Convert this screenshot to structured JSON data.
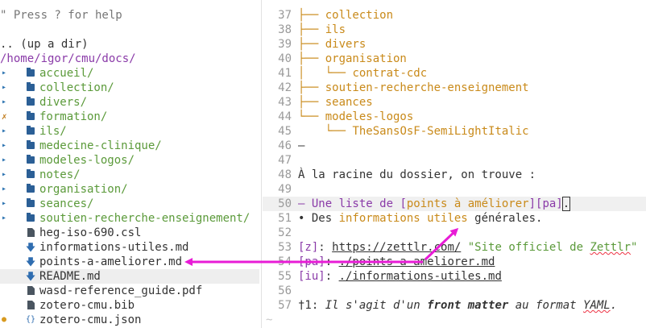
{
  "tree": {
    "help": "\" Press ? for help",
    "up_dir": ".. (up a dir)",
    "root_path": "/home/igor/cmu/docs/",
    "items": [
      {
        "type": "dir",
        "name": "accueil/",
        "glyph": "▸"
      },
      {
        "type": "dir",
        "name": "collection/",
        "glyph": "▸"
      },
      {
        "type": "dir",
        "name": "divers/",
        "glyph": "▸"
      },
      {
        "type": "dir",
        "name": "formation/",
        "glyph": "✗"
      },
      {
        "type": "dir",
        "name": "ils/",
        "glyph": "▸"
      },
      {
        "type": "dir",
        "name": "medecine-clinique/",
        "glyph": "▸"
      },
      {
        "type": "dir",
        "name": "modeles-logos/",
        "glyph": "▸"
      },
      {
        "type": "dir",
        "name": "notes/",
        "glyph": "▸"
      },
      {
        "type": "dir",
        "name": "organisation/",
        "glyph": "▸"
      },
      {
        "type": "dir",
        "name": "seances/",
        "glyph": "▸"
      },
      {
        "type": "dir",
        "name": "soutien-recherche-enseignement/",
        "glyph": "▸"
      },
      {
        "type": "file",
        "name": "heg-iso-690.csl",
        "icon": "file-icon"
      },
      {
        "type": "md",
        "name": "informations-utiles.md",
        "icon": "markdown-icon"
      },
      {
        "type": "md",
        "name": "points-a-ameliorer.md",
        "icon": "markdown-icon"
      },
      {
        "type": "md",
        "name": "README.md",
        "icon": "markdown-icon",
        "selected": true
      },
      {
        "type": "file",
        "name": "wasd-reference_guide.pdf",
        "icon": "file-icon"
      },
      {
        "type": "file",
        "name": "zotero-cmu.bib",
        "icon": "file-icon"
      },
      {
        "type": "json",
        "name": "zotero-cmu.json",
        "icon": "json-icon",
        "glyph": "●"
      }
    ]
  },
  "editor": {
    "lines": [
      {
        "n": "37",
        "segs": [
          {
            "t": "├── ",
            "c": "orange"
          },
          {
            "t": "collection",
            "c": "orange"
          }
        ]
      },
      {
        "n": "38",
        "segs": [
          {
            "t": "├── ",
            "c": "orange"
          },
          {
            "t": "ils",
            "c": "orange"
          }
        ]
      },
      {
        "n": "39",
        "segs": [
          {
            "t": "├── ",
            "c": "orange"
          },
          {
            "t": "divers",
            "c": "orange"
          }
        ]
      },
      {
        "n": "40",
        "segs": [
          {
            "t": "├── ",
            "c": "orange"
          },
          {
            "t": "organisation",
            "c": "orange"
          }
        ]
      },
      {
        "n": "41",
        "segs": [
          {
            "t": "│   └── ",
            "c": "orange"
          },
          {
            "t": "contrat-cdc",
            "c": "orange"
          }
        ]
      },
      {
        "n": "42",
        "segs": [
          {
            "t": "├── ",
            "c": "orange"
          },
          {
            "t": "soutien-recherche-enseignement",
            "c": "orange"
          }
        ]
      },
      {
        "n": "43",
        "segs": [
          {
            "t": "├── ",
            "c": "orange"
          },
          {
            "t": "seances",
            "c": "orange"
          }
        ]
      },
      {
        "n": "44",
        "segs": [
          {
            "t": "└── ",
            "c": "orange"
          },
          {
            "t": "modeles-logos",
            "c": "orange"
          }
        ]
      },
      {
        "n": "45",
        "segs": [
          {
            "t": "    └── ",
            "c": "orange"
          },
          {
            "t": "TheSansOsF-SemiLightItalic",
            "c": "orange"
          }
        ]
      },
      {
        "n": "46",
        "segs": [
          {
            "t": "—",
            "c": "plain"
          }
        ]
      },
      {
        "n": "47",
        "segs": []
      },
      {
        "n": "48",
        "segs": [
          {
            "t": "À la racine du dossier, on trouve :",
            "c": "plain"
          }
        ]
      },
      {
        "n": "49",
        "segs": []
      },
      {
        "n": "50",
        "cur": true,
        "segs": [
          {
            "t": "– ",
            "c": "purp"
          },
          {
            "t": "Une liste de ",
            "c": "purp"
          },
          {
            "t": "[",
            "c": "purp"
          },
          {
            "t": "points à améliorer",
            "c": "orange"
          },
          {
            "t": "][pa]",
            "c": "purp"
          },
          {
            "t": ".",
            "c": "cursor"
          }
        ]
      },
      {
        "n": "51",
        "segs": [
          {
            "t": "• Des ",
            "c": "plain"
          },
          {
            "t": "informations utiles",
            "c": "orange"
          },
          {
            "t": " générales.",
            "c": "plain"
          }
        ]
      },
      {
        "n": "52",
        "segs": []
      },
      {
        "n": "53",
        "segs": [
          {
            "t": "[z]",
            "c": "purp"
          },
          {
            "t": ": ",
            "c": "plain"
          },
          {
            "t": "https://zettlr.com/",
            "c": "link"
          },
          {
            "t": " ",
            "c": "plain"
          },
          {
            "t": "\"Site officiel de ",
            "c": "str"
          },
          {
            "t": "Zettlr",
            "c": "strspell"
          },
          {
            "t": "\"",
            "c": "str"
          }
        ]
      },
      {
        "n": "54",
        "segs": [
          {
            "t": "[pa]",
            "c": "purp"
          },
          {
            "t": ": ",
            "c": "plain"
          },
          {
            "t": "./points-a-ameliorer.md",
            "c": "link"
          }
        ]
      },
      {
        "n": "55",
        "segs": [
          {
            "t": "[iu]",
            "c": "purp"
          },
          {
            "t": ": ",
            "c": "plain"
          },
          {
            "t": "./informations-utiles.md",
            "c": "link"
          }
        ]
      },
      {
        "n": "56",
        "segs": []
      },
      {
        "n": "57",
        "segs": [
          {
            "t": "†1",
            "c": "plain"
          },
          {
            "t": ": ",
            "c": "plain"
          },
          {
            "t": "Il s'agit d'un ",
            "c": "it"
          },
          {
            "t": "front matter",
            "c": "itb"
          },
          {
            "t": " au format ",
            "c": "it"
          },
          {
            "t": "YAML",
            "c": "itspell"
          },
          {
            "t": ".",
            "c": "it"
          }
        ]
      }
    ],
    "end_tilde": "~"
  },
  "colors": {
    "arrow": "#e81cd6",
    "dir": "#5b9a3a",
    "orange": "#c98a1a",
    "purple": "#8a3aa8"
  }
}
